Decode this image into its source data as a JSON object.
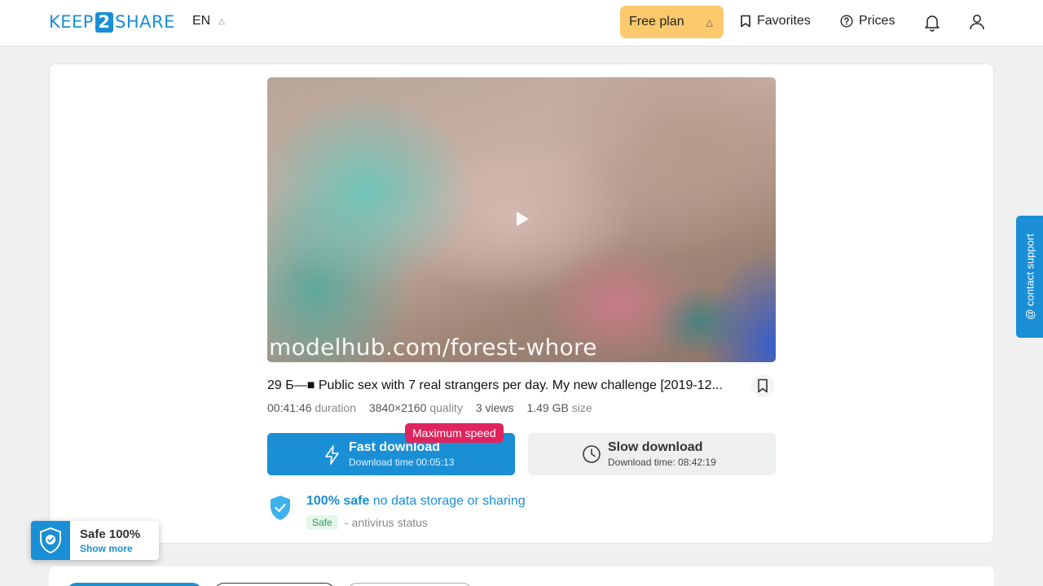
{
  "header": {
    "logo_left": "KEEP",
    "logo_mid": "2",
    "logo_right": "SHARE",
    "language": "EN",
    "plan_label": "Free plan",
    "favorites_label": "Favorites",
    "prices_label": "Prices"
  },
  "video": {
    "watermark": "modelhub.com/forest-whore"
  },
  "file": {
    "title": "29 Б—■ Public sex with 7 real strangers per day. My new challenge [2019-12...",
    "duration_value": "00:41:46",
    "duration_label": "duration",
    "quality_value": "3840×2160",
    "quality_label": "quality",
    "views_value": "3 views",
    "size_value": "1.49 GB",
    "size_label": "size"
  },
  "download": {
    "badge": "Maximum speed",
    "fast_label": "Fast download",
    "fast_time": "Download time 00:05:13",
    "slow_label": "Slow download",
    "slow_time": "Download time: 08:42:19"
  },
  "safety": {
    "title_strong": "100% safe",
    "title_rest": "no data storage or sharing",
    "tag": "Safe",
    "note": "- antivirus status"
  },
  "support": {
    "label": "@ contact support"
  },
  "widget": {
    "title": "Safe 100%",
    "link": "Show more"
  },
  "colors": {
    "accent": "#1a8fd6",
    "plan": "#fcc96d",
    "badge": "#e0245e"
  }
}
